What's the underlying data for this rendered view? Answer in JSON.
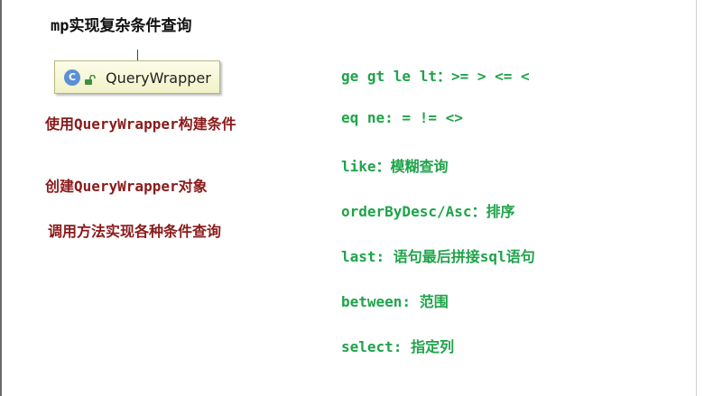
{
  "slide": {
    "title": "mp实现复杂条件查询"
  },
  "class_box": {
    "icon_letter": "C",
    "class_name": "QueryWrapper",
    "icon": "class-icon",
    "access_icon": "lock-open-icon"
  },
  "notes": [
    "使用QueryWrapper构建条件",
    "创建QueryWrapper对象",
    "调用方法实现各种条件查询"
  ],
  "methods": [
    "ge gt le lt：>= > <= <",
    "eq ne: =  != <>",
    "like：模糊查询",
    "orderByDesc/Asc：排序",
    "last: 语句最后拼接sql语句",
    "between: 范围",
    "select: 指定列"
  ],
  "colors": {
    "notes": "#8b1a1a",
    "methods": "#1fa34a",
    "class_icon": "#5b8fd6"
  }
}
